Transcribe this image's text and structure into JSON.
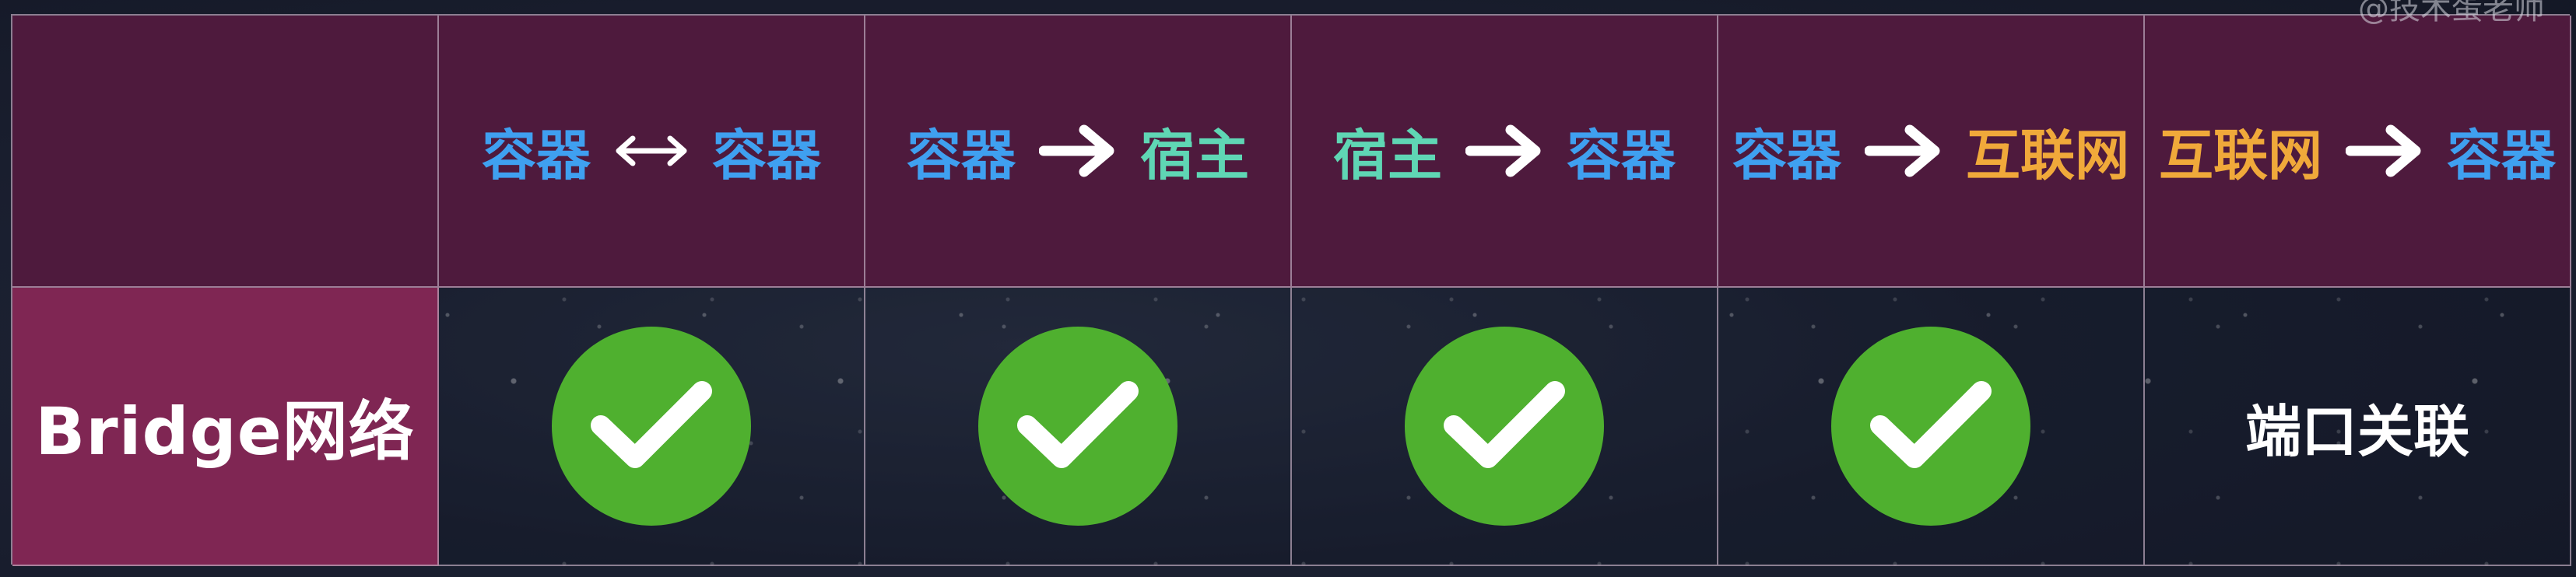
{
  "colors": {
    "container": "#3fa0f0",
    "host": "#5fd6b4",
    "internet": "#f0a93a",
    "arrow": "#ffffff",
    "check": "#4fb02f",
    "header_bg": "#4e1a3d",
    "row_label_bg": "#7f2653"
  },
  "corner_watermark": "@技术蛋老师",
  "table": {
    "corner": "",
    "columns": [
      {
        "from": "容器",
        "from_kind": "container",
        "arrow": "both",
        "to": "容器",
        "to_kind": "container"
      },
      {
        "from": "容器",
        "from_kind": "container",
        "arrow": "right",
        "to": "宿主",
        "to_kind": "host"
      },
      {
        "from": "宿主",
        "from_kind": "host",
        "arrow": "right",
        "to": "容器",
        "to_kind": "container"
      },
      {
        "from": "容器",
        "from_kind": "container",
        "arrow": "right",
        "to": "互联网",
        "to_kind": "internet"
      },
      {
        "from": "互联网",
        "from_kind": "internet",
        "arrow": "right",
        "to": "容器",
        "to_kind": "container"
      }
    ],
    "rows": [
      {
        "label": "Bridge网络",
        "cells": [
          {
            "type": "check",
            "icon": "check-icon"
          },
          {
            "type": "check",
            "icon": "check-icon"
          },
          {
            "type": "check",
            "icon": "check-icon"
          },
          {
            "type": "check",
            "icon": "check-icon"
          },
          {
            "type": "text",
            "text": "端口关联"
          }
        ]
      }
    ]
  }
}
